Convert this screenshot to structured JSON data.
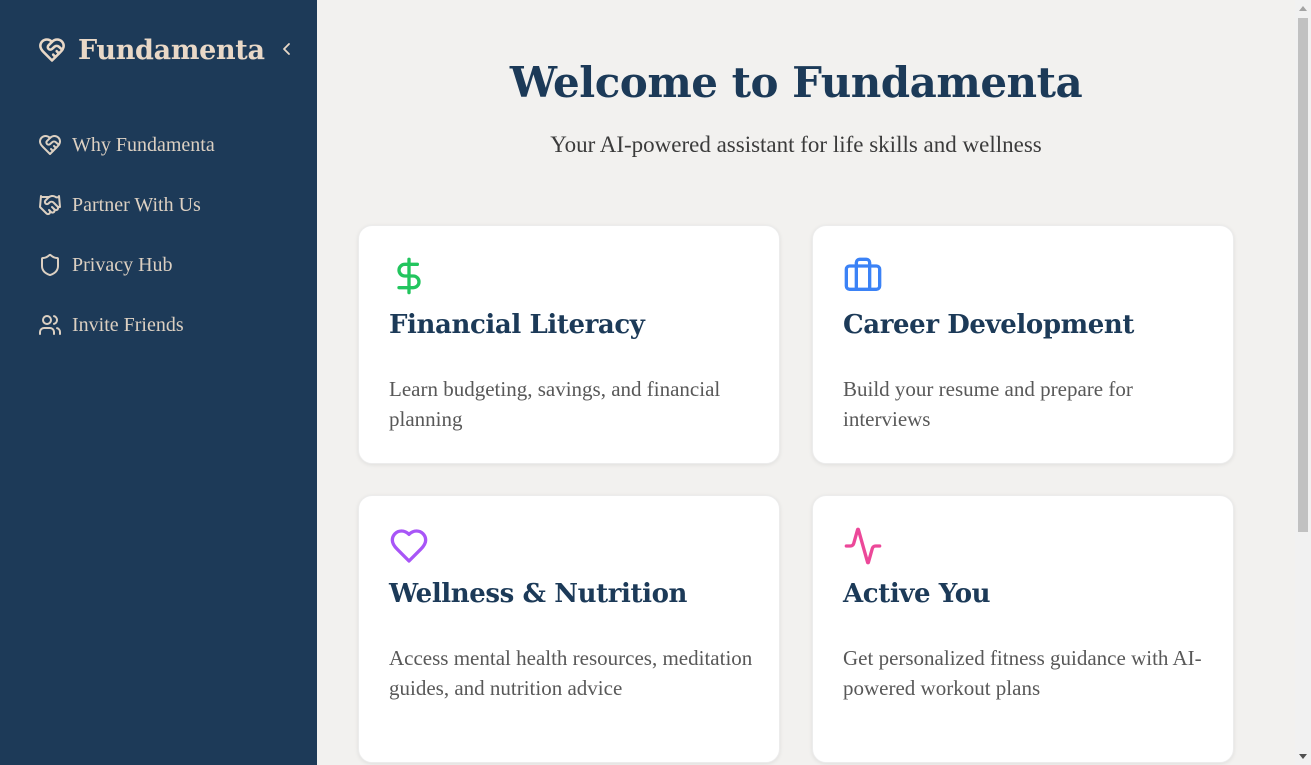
{
  "sidebar": {
    "brand": "Fundamenta",
    "items": [
      {
        "label": "Why Fundamenta",
        "icon": "heart-handshake-icon"
      },
      {
        "label": "Partner With Us",
        "icon": "handshake-icon"
      },
      {
        "label": "Privacy Hub",
        "icon": "shield-icon"
      },
      {
        "label": "Invite Friends",
        "icon": "users-icon"
      }
    ]
  },
  "main": {
    "title": "Welcome to Fundamenta",
    "subtitle": "Your AI-powered assistant for life skills and wellness",
    "cards": [
      {
        "title": "Financial Literacy",
        "description": "Learn budgeting, savings, and financial planning",
        "icon": "dollar-icon",
        "color": "#22c55e"
      },
      {
        "title": "Career Development",
        "description": "Build your resume and prepare for interviews",
        "icon": "briefcase-icon",
        "color": "#3b82f6"
      },
      {
        "title": "Wellness & Nutrition",
        "description": "Access mental health resources, meditation guides, and nutrition advice",
        "icon": "heart-icon",
        "color": "#a855f7"
      },
      {
        "title": "Active You",
        "description": "Get personalized fitness guidance with AI-powered workout plans",
        "icon": "activity-icon",
        "color": "#ec4899"
      }
    ]
  },
  "colors": {
    "sidebar_bg": "#1d3a58",
    "brand_text": "#e9d8c7",
    "heading": "#1c3a58"
  }
}
